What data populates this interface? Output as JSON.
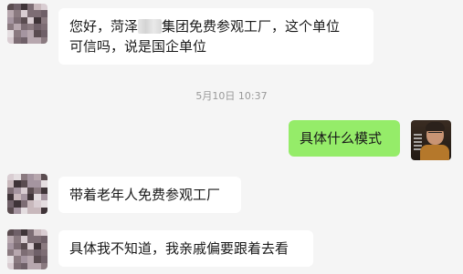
{
  "messages": [
    {
      "side": "left",
      "text_line1_prefix": "您好，菏泽",
      "text_line1_suffix": "集团免费参观工厂，这个单位",
      "text_line2": "可信吗，说是国企单位"
    },
    {
      "side": "right",
      "text": "具体什么模式"
    },
    {
      "side": "left",
      "text": "带着老年人免费参观工厂"
    },
    {
      "side": "left",
      "text": "具体我不知道，我亲戚偏要跟着去看"
    }
  ],
  "timestamp": "5月10日 10:37",
  "colors": {
    "background": "#f5f5f5",
    "incoming_bubble": "#ffffff",
    "outgoing_bubble": "#95ec69",
    "timestamp_text": "#999999"
  },
  "icons": {
    "contact_avatar": "pixelated-avatar-icon",
    "user_avatar": "photo-avatar-icon"
  }
}
